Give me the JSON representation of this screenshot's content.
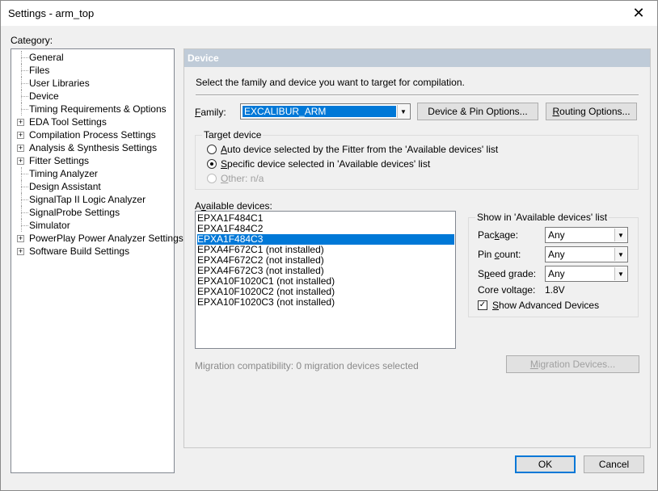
{
  "window": {
    "title": "Settings - arm_top",
    "close_glyph": "✕"
  },
  "category": {
    "label": "Category:",
    "items": [
      {
        "label": "General",
        "expandable": false
      },
      {
        "label": "Files",
        "expandable": false
      },
      {
        "label": "User Libraries",
        "expandable": false
      },
      {
        "label": "Device",
        "expandable": false
      },
      {
        "label": "Timing Requirements & Options",
        "expandable": false
      },
      {
        "label": "EDA Tool Settings",
        "expandable": true
      },
      {
        "label": "Compilation Process Settings",
        "expandable": true
      },
      {
        "label": "Analysis & Synthesis Settings",
        "expandable": true
      },
      {
        "label": "Fitter Settings",
        "expandable": true
      },
      {
        "label": "Timing Analyzer",
        "expandable": false
      },
      {
        "label": "Design Assistant",
        "expandable": false
      },
      {
        "label": "SignalTap II Logic Analyzer",
        "expandable": false
      },
      {
        "label": "SignalProbe Settings",
        "expandable": false
      },
      {
        "label": "Simulator",
        "expandable": false
      },
      {
        "label": "PowerPlay Power Analyzer Settings",
        "expandable": true
      },
      {
        "label": "Software Build Settings",
        "expandable": true
      }
    ]
  },
  "panel": {
    "header": "Device",
    "description": "Select the family and device you want to target for compilation.",
    "family_label_pre": "",
    "family_label_ul": "F",
    "family_label_post": "amily:",
    "family_value": "EXCALIBUR_ARM",
    "device_pin_options": "Device & Pin Options...",
    "routing_options_ul": "R",
    "routing_options_post": "outing Options...",
    "target_device": {
      "title": "Target device",
      "auto_ul": "A",
      "auto_post": "uto device selected by the Fitter from the 'Available devices' list",
      "specific_ul": "S",
      "specific_post": "pecific device selected in 'Available devices' list",
      "other_ul": "O",
      "other_post": "ther:  n/a"
    },
    "available_label_pre": "A",
    "available_label_ul": "v",
    "available_label_post": "ailable devices:",
    "devices": [
      {
        "name": "EPXA1F484C1",
        "selected": false
      },
      {
        "name": "EPXA1F484C2",
        "selected": false
      },
      {
        "name": "EPXA1F484C3",
        "selected": true
      },
      {
        "name": "EPXA4F672C1 (not installed)",
        "selected": false
      },
      {
        "name": "EPXA4F672C2 (not installed)",
        "selected": false
      },
      {
        "name": "EPXA4F672C3 (not installed)",
        "selected": false
      },
      {
        "name": "EPXA10F1020C1 (not installed)",
        "selected": false
      },
      {
        "name": "EPXA10F1020C2 (not installed)",
        "selected": false
      },
      {
        "name": "EPXA10F1020C3 (not installed)",
        "selected": false
      }
    ],
    "show_group": {
      "title": "Show in 'Available devices' list",
      "package_pre": "Pac",
      "package_ul": "k",
      "package_post": "age:",
      "package_value": "Any",
      "pin_pre": "Pin ",
      "pin_ul": "c",
      "pin_post": "ount:",
      "pin_value": "Any",
      "speed_pre": "S",
      "speed_ul": "p",
      "speed_post": "eed grade:",
      "speed_value": "Any",
      "core_voltage_label": "Core voltage:",
      "core_voltage_value": "1.8V",
      "show_advanced_ul": "S",
      "show_advanced_post": "how Advanced Devices",
      "show_advanced_checked": true
    },
    "migration_text": "Migration compatibility: 0 migration devices selected",
    "migration_button_ul": "M",
    "migration_button_post": "igration Devices..."
  },
  "footer": {
    "ok": "OK",
    "cancel": "Cancel"
  }
}
